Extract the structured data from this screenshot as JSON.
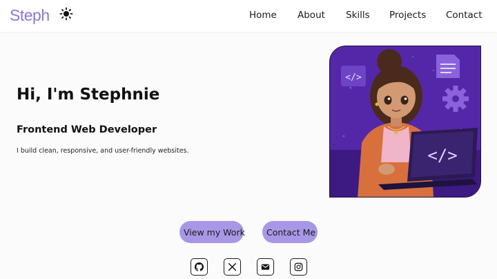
{
  "brand": {
    "logo_text": "Steph",
    "accent_color": "#8b78d8"
  },
  "header": {
    "theme_toggle_icon": "sun-icon"
  },
  "nav": {
    "items": [
      {
        "label": "Home"
      },
      {
        "label": "About"
      },
      {
        "label": "Skills"
      },
      {
        "label": "Projects"
      },
      {
        "label": "Contact"
      }
    ]
  },
  "hero": {
    "title": "Hi, I'm Stephnie",
    "subtitle": "Frontend Web Developer",
    "description": "I build clean, responsive, and user-friendly websites.",
    "avatar_alt": "Illustrated developer avatar"
  },
  "actions": {
    "primary_label": "View my Work",
    "secondary_label": "Contact Me",
    "button_color": "#a897e6"
  },
  "socials": [
    {
      "icon": "github-icon"
    },
    {
      "icon": "x-icon"
    },
    {
      "icon": "mail-icon"
    },
    {
      "icon": "instagram-icon"
    }
  ]
}
